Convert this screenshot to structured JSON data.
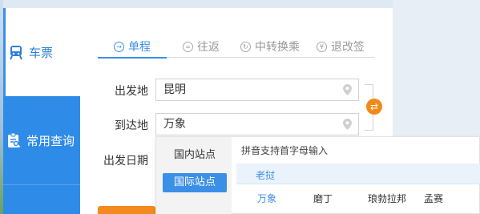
{
  "sidebar": {
    "items": [
      {
        "label": "车票",
        "icon": "train-icon",
        "active": true
      },
      {
        "label": "常用查询",
        "icon": "clipboard-search-icon",
        "active": false
      }
    ]
  },
  "tabs": [
    {
      "label": "单程",
      "icon": "arrow-right-circle-icon",
      "active": true
    },
    {
      "label": "往返",
      "icon": "equals-circle-icon",
      "active": false
    },
    {
      "label": "中转换乘",
      "icon": "transfer-circle-icon",
      "active": false
    },
    {
      "label": "退改签",
      "icon": "refund-circle-icon",
      "active": false
    }
  ],
  "form": {
    "from_label": "出发地",
    "from_value": "昆明",
    "to_label": "到达地",
    "to_value": "万象",
    "date_label": "出发日期"
  },
  "dropdown": {
    "categories": [
      {
        "label": "国内站点",
        "active": false
      },
      {
        "label": "国际站点",
        "active": true
      }
    ],
    "hint": "拼音支持首字母输入",
    "country_tab": "老挝",
    "cities": [
      {
        "label": "万象",
        "highlighted": true
      },
      {
        "label": "磨丁",
        "highlighted": false
      },
      {
        "label": "琅勃拉邦",
        "highlighted": false
      },
      {
        "label": "孟赛",
        "highlighted": false
      }
    ]
  },
  "colors": {
    "accent": "#3b8fe6",
    "sidebar_blue": "#2f8be8",
    "swap_orange": "#f08a19"
  }
}
